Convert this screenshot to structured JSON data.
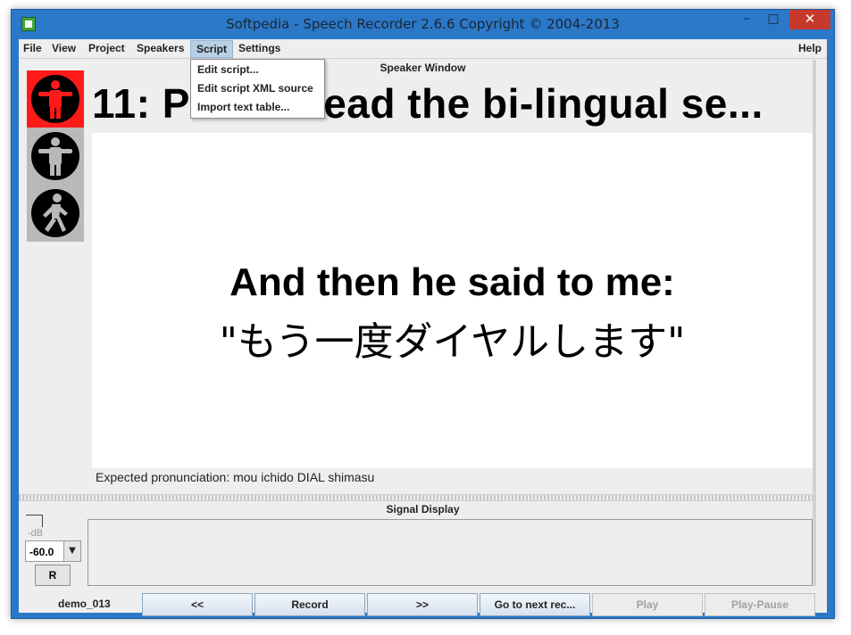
{
  "window": {
    "title": "Softpedia - Speech Recorder 2.6.6 Copyright © 2004-2013"
  },
  "window_controls": {
    "minimize": "–",
    "maximize": "□",
    "close": "✕"
  },
  "menubar": {
    "file": "File",
    "view": "View",
    "project": "Project",
    "speakers": "Speakers",
    "script": "Script",
    "settings": "Settings",
    "help": "Help"
  },
  "script_menu": {
    "items": [
      "Edit script...",
      "Edit script XML source",
      "Import text table..."
    ]
  },
  "speaker_window": {
    "label": "Speaker Window",
    "prompt_title": "11:  Please read the bi-lingual se...",
    "prompt_line1": "And then he said to me:",
    "prompt_line2": "\"もう一度ダイヤルします\"",
    "expected_pronunciation": "Expected pronunciation: mou ichido DIAL shimasu",
    "traffic_light": {
      "active": "red",
      "icons": [
        "stop-figure-icon",
        "wait-figure-icon",
        "go-figure-icon"
      ]
    }
  },
  "signal_display": {
    "label": "Signal Display",
    "db_unit": "-dB",
    "level_value": "-60.0",
    "reset_label": "R"
  },
  "controls": {
    "session": "demo_013",
    "prev": "<<",
    "record": "Record",
    "next": ">>",
    "go_next": "Go to next rec...",
    "play": "Play",
    "play_pause": "Play-Pause"
  },
  "colors": {
    "titlebar": "#2b78c8",
    "close_button": "#c7392c",
    "light_active": "#ff1a1a",
    "panel": "#eeeeee"
  }
}
